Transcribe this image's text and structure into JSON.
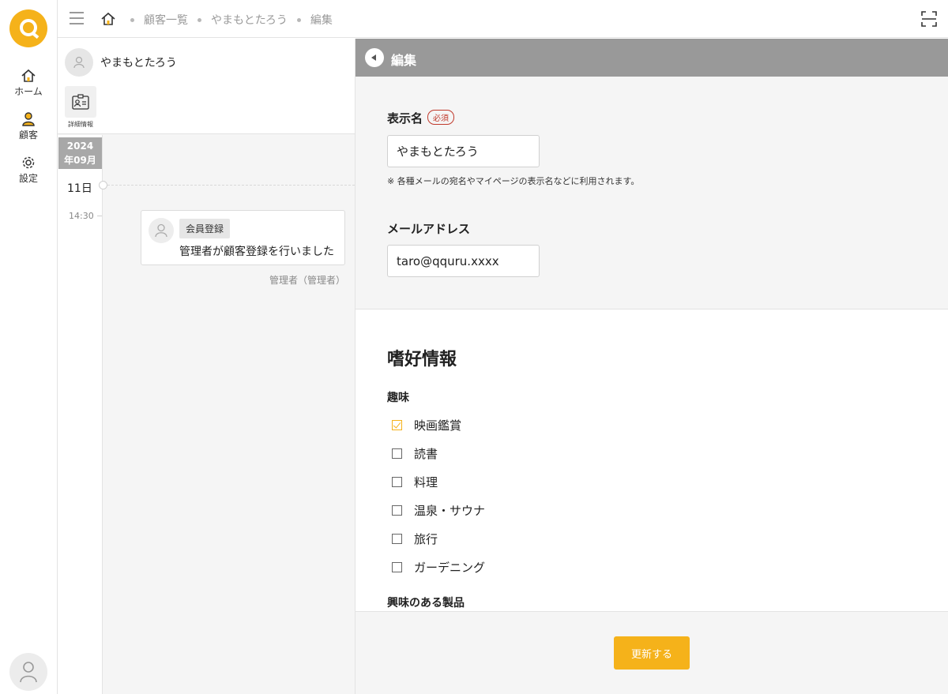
{
  "rail": {
    "nav": [
      {
        "label": "ホーム",
        "icon": "home-icon"
      },
      {
        "label": "顧客",
        "icon": "person-icon"
      },
      {
        "label": "設定",
        "icon": "gear-icon"
      }
    ]
  },
  "topbar": {
    "breadcrumbs": [
      "顧客一覧",
      "やまもとたろう",
      "編集"
    ]
  },
  "customer": {
    "name": "やまもとたろう",
    "detail_label": "詳細情報"
  },
  "timeline": {
    "year": "2024",
    "month": "年09月",
    "day": "11日",
    "time": "14:30",
    "event": {
      "tag": "会員登録",
      "text": "管理者が顧客登録を行いました",
      "by": "管理者（管理者）"
    }
  },
  "edit": {
    "title": "編集",
    "display_name_label": "表示名",
    "required_badge": "必須",
    "display_name_value": "やまもとたろう",
    "display_name_note": "※ 各種メールの宛名やマイページの表示名などに利用されます。",
    "email_label": "メールアドレス",
    "email_value": "taro@qquru.xxxx",
    "preferences_title": "嗜好情報",
    "hobby_label": "趣味",
    "hobbies": [
      {
        "label": "映画鑑賞",
        "checked": true
      },
      {
        "label": "読書",
        "checked": false
      },
      {
        "label": "料理",
        "checked": false
      },
      {
        "label": "温泉・サウナ",
        "checked": false
      },
      {
        "label": "旅行",
        "checked": false
      },
      {
        "label": "ガーデニング",
        "checked": false
      }
    ],
    "interest_label": "興味のある製品",
    "submit_label": "更新する"
  },
  "colors": {
    "accent": "#f5b21a",
    "edit_bar": "#999999",
    "required": "#c0392b"
  }
}
